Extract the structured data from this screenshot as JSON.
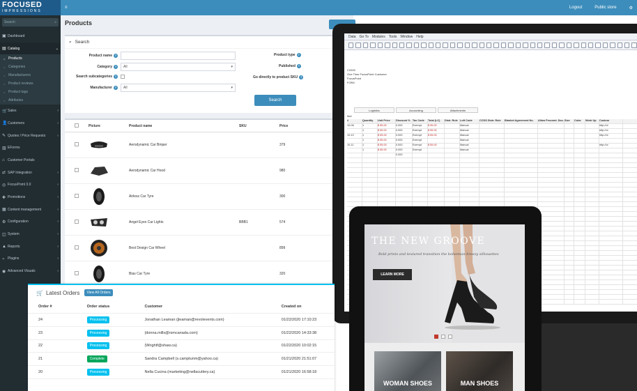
{
  "brand": {
    "line1": "FOCUSED",
    "line2": "IMPRESSIONS"
  },
  "topbar": {
    "menu_icon": "hamburger-icon",
    "logout": "Logout",
    "public_store": "Public store",
    "settings_icon": "gear-icon"
  },
  "sidebar": {
    "search_placeholder": "Search",
    "items": [
      {
        "label": "Dashboard",
        "icon": "dashboard-icon"
      },
      {
        "label": "Catalog",
        "icon": "catalog-icon"
      },
      {
        "label": "Products"
      },
      {
        "label": "Categories"
      },
      {
        "label": "Manufacturers"
      },
      {
        "label": "Product reviews"
      },
      {
        "label": "Product tags"
      },
      {
        "label": "Attributes"
      },
      {
        "label": "Sales",
        "icon": "cart-icon"
      },
      {
        "label": "Customers",
        "icon": "users-icon"
      },
      {
        "label": "Quotes / Price Requests",
        "icon": "quote-icon"
      },
      {
        "label": "EForms",
        "icon": "form-icon"
      },
      {
        "label": "Customer Portals",
        "icon": "portal-icon"
      },
      {
        "label": "SAP Integration",
        "icon": "sap-icon"
      },
      {
        "label": "FocusPoint 3.0",
        "icon": "focus-icon"
      },
      {
        "label": "Promotions",
        "icon": "tag-icon"
      },
      {
        "label": "Content management",
        "icon": "content-icon"
      },
      {
        "label": "Configuration",
        "icon": "gear-icon"
      },
      {
        "label": "System",
        "icon": "cube-icon"
      },
      {
        "label": "Reports",
        "icon": "chart-icon"
      },
      {
        "label": "Plugins",
        "icon": "plug-icon"
      },
      {
        "label": "Advanced Visuals",
        "icon": "eye-icon"
      }
    ]
  },
  "page": {
    "title": "Products"
  },
  "search_panel": {
    "title": "Search",
    "product_name_label": "Product name",
    "category_label": "Category",
    "category_value": "All",
    "subcat_label": "Search subcategories",
    "manufacturer_label": "Manufacturer",
    "manufacturer_value": "All",
    "product_type_label": "Product type",
    "published_label": "Published",
    "sku_label": "Go directly to product SKU",
    "search_button": "Search"
  },
  "products": {
    "columns": [
      "Picture",
      "Product name",
      "SKU",
      "Price"
    ],
    "rows": [
      {
        "name": "Aerodynamic Car Bmper",
        "sku": "",
        "price": "379",
        "pic": "bumper"
      },
      {
        "name": "Aerodynamic Car Hood",
        "sku": "",
        "price": "980",
        "pic": "hood"
      },
      {
        "name": "Airless Car Tyre",
        "sku": "",
        "price": "300",
        "pic": "tyre"
      },
      {
        "name": "Angel Eyes Car Lights",
        "sku": "BBB1",
        "price": "574",
        "pic": "lights"
      },
      {
        "name": "Best Design Car Wheel",
        "sku": "",
        "price": "899",
        "pic": "wheel"
      },
      {
        "name": "Bias Car Tyre",
        "sku": "",
        "price": "320",
        "pic": "tyre"
      }
    ]
  },
  "orders": {
    "title": "Latest Orders",
    "view_all": "View All Orders",
    "columns": [
      "Order #",
      "Order status",
      "Customer",
      "Created on"
    ],
    "rows": [
      {
        "num": "24",
        "status": "Processing",
        "customer": "Jonathan Leaman (jleaman@revolevents.com)",
        "created": "01/22/2020 17:10:23"
      },
      {
        "num": "23",
        "status": "Processing",
        "customer": "(donna.mills@rsmcanada.com)",
        "created": "01/22/2020 14:33:38"
      },
      {
        "num": "22",
        "status": "Processing",
        "customer": "(Wrightf@shaw.ca)",
        "created": "01/22/2020 10:02:15"
      },
      {
        "num": "21",
        "status": "Complete",
        "customer": "Sandra Campbell (s.camptunm@yahoo.ca)",
        "created": "01/21/2020 21:51:07"
      },
      {
        "num": "20",
        "status": "Processing",
        "customer": "Nella Cucina (marketing@nellacutlery.ca)",
        "created": "01/21/2020 16:58:18"
      }
    ]
  },
  "erp": {
    "menu": [
      "Data",
      "Go To",
      "Modules",
      "Tools",
      "Window",
      "Help"
    ],
    "fields": [
      "C2000",
      "One Time FocusPoint Customer",
      "FocusPoint",
      "FOR6"
    ],
    "tabs": [
      "Logistics",
      "Accounting",
      "Attachments"
    ],
    "grid_label": "Item",
    "columns": [
      "#",
      "Quantity",
      "Unit Price",
      "Discount %",
      "Tax Code",
      "Total (LC)",
      "Distr. Rule",
      "Loft Code",
      "CCDS Distr. Rule",
      "Blanket Agreement No.",
      "Allow Procmnt. Doc.",
      "Size",
      "Color",
      "Work Up",
      "Custom"
    ],
    "rows": [
      [
        "10-06",
        "1",
        "$ 55.00",
        "0.000",
        "Exempt",
        "$ 55.00",
        "",
        "Manual",
        "",
        "",
        "",
        "",
        "",
        "",
        "http://ol"
      ],
      [
        "",
        "1",
        "$ 55.00",
        "0.000",
        "Exempt",
        "$ 55.00",
        "",
        "Manual",
        "",
        "",
        "",
        "",
        "",
        "",
        "http://ol"
      ],
      [
        "10-10",
        "1",
        "$ 55.00",
        "0.000",
        "Exempt",
        "$ 55.00",
        "",
        "Manual",
        "",
        "",
        "",
        "",
        "",
        "",
        "http://ol"
      ],
      [
        "",
        "1",
        "$ 55.00",
        "0.000",
        "Exempt",
        "",
        "",
        "Manual",
        "",
        "",
        "",
        "",
        "",
        "",
        ""
      ],
      [
        "10-11",
        "1",
        "$ 55.00",
        "0.000",
        "Exempt",
        "$ 55.00",
        "",
        "Manual",
        "",
        "",
        "",
        "",
        "",
        "",
        "http://ol"
      ],
      [
        "",
        "1",
        "$ 55.00",
        "0.000",
        "Exempt",
        "",
        "",
        "Manual",
        "",
        "",
        "",
        "",
        "",
        "",
        ""
      ],
      [
        "",
        "",
        "",
        "0.000",
        "",
        "",
        "",
        "",
        "",
        "",
        "",
        "",
        "",
        "",
        ""
      ]
    ]
  },
  "shop": {
    "headline": "THE NEW GROOVE",
    "subline": "Bold prints and textured transition the bohemian breezy silhouettes",
    "cta": "LEARN MORE",
    "woman": "WOMAN SHOES",
    "man": "MAN SHOES"
  },
  "colors": {
    "brand_blue": "#3c8dbc",
    "sidebar": "#222d32",
    "processing": "#00c0ef",
    "complete": "#00a65a"
  }
}
